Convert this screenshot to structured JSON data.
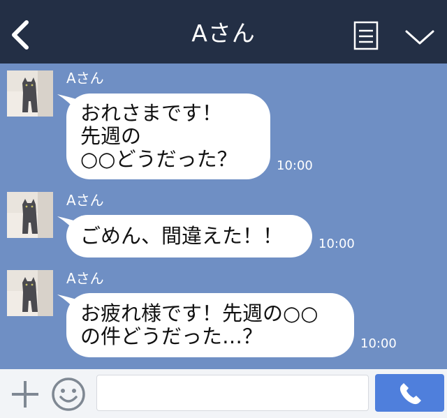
{
  "header": {
    "title": "Aさん",
    "back_icon": "chevron-left-icon",
    "menu_icon": "list-icon",
    "expand_icon": "chevron-down-icon",
    "background": "#232f45"
  },
  "chat": {
    "background": "#6f8fc4",
    "messages": [
      {
        "sender": "Aさん",
        "text": "おれさまです！\n先週の\n○○どうだった？",
        "time": "10:00"
      },
      {
        "sender": "Aさん",
        "text": "ごめん、間違えた！！",
        "time": "10:00"
      },
      {
        "sender": "Aさん",
        "text": "お疲れ様です！先週の○○\nの件どうだった…？",
        "time": "10:00"
      }
    ]
  },
  "footer": {
    "input_value": "",
    "plus_icon": "plus-icon",
    "emoji_icon": "smile-icon",
    "call_icon": "phone-icon",
    "call_button_color": "#4f7fdc"
  }
}
